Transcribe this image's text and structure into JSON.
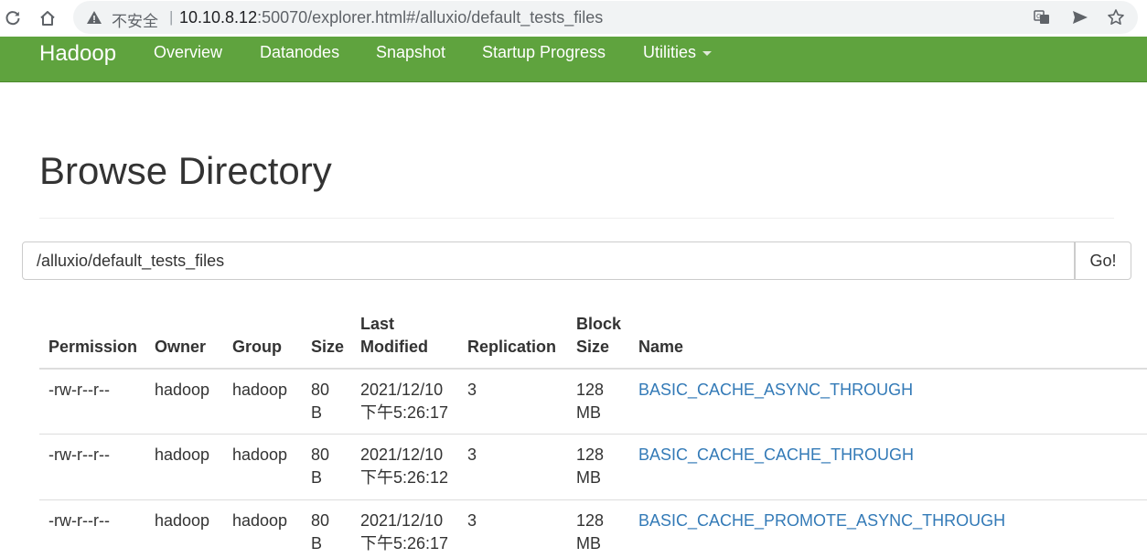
{
  "browser": {
    "insecure_label": "不安全",
    "separator": "|",
    "url_host": "10.10.8.12",
    "url_rest": ":50070/explorer.html#/alluxio/default_tests_files"
  },
  "navbar": {
    "brand": "Hadoop",
    "items": [
      "Overview",
      "Datanodes",
      "Snapshot",
      "Startup Progress",
      "Utilities"
    ]
  },
  "page": {
    "title": "Browse Directory",
    "path_value": "/alluxio/default_tests_files",
    "go_label": "Go!"
  },
  "table": {
    "headers": {
      "permission": "Permission",
      "owner": "Owner",
      "group": "Group",
      "size": "Size",
      "last_modified_1": "Last",
      "last_modified_2": "Modified",
      "replication": "Replication",
      "block_size_1": "Block",
      "block_size_2": "Size",
      "name": "Name"
    },
    "rows": [
      {
        "permission": "-rw-r--r--",
        "owner": "hadoop",
        "group": "hadoop",
        "size_1": "80",
        "size_2": "B",
        "modified_1": "2021/12/10",
        "modified_2": "下午5:26:17",
        "replication": "3",
        "block_1": "128",
        "block_2": "MB",
        "name": "BASIC_CACHE_ASYNC_THROUGH"
      },
      {
        "permission": "-rw-r--r--",
        "owner": "hadoop",
        "group": "hadoop",
        "size_1": "80",
        "size_2": "B",
        "modified_1": "2021/12/10",
        "modified_2": "下午5:26:12",
        "replication": "3",
        "block_1": "128",
        "block_2": "MB",
        "name": "BASIC_CACHE_CACHE_THROUGH"
      },
      {
        "permission": "-rw-r--r--",
        "owner": "hadoop",
        "group": "hadoop",
        "size_1": "80",
        "size_2": "B",
        "modified_1": "2021/12/10",
        "modified_2": "下午5:26:17",
        "replication": "3",
        "block_1": "128",
        "block_2": "MB",
        "name": "BASIC_CACHE_PROMOTE_ASYNC_THROUGH"
      }
    ]
  },
  "colors": {
    "navbar": "#5fa33e",
    "link": "#337ab7",
    "text": "#333333"
  },
  "icons": [
    "reload-icon",
    "home-icon",
    "warning-icon",
    "translate-icon",
    "send-icon",
    "star-icon",
    "dropdown-caret-icon"
  ]
}
